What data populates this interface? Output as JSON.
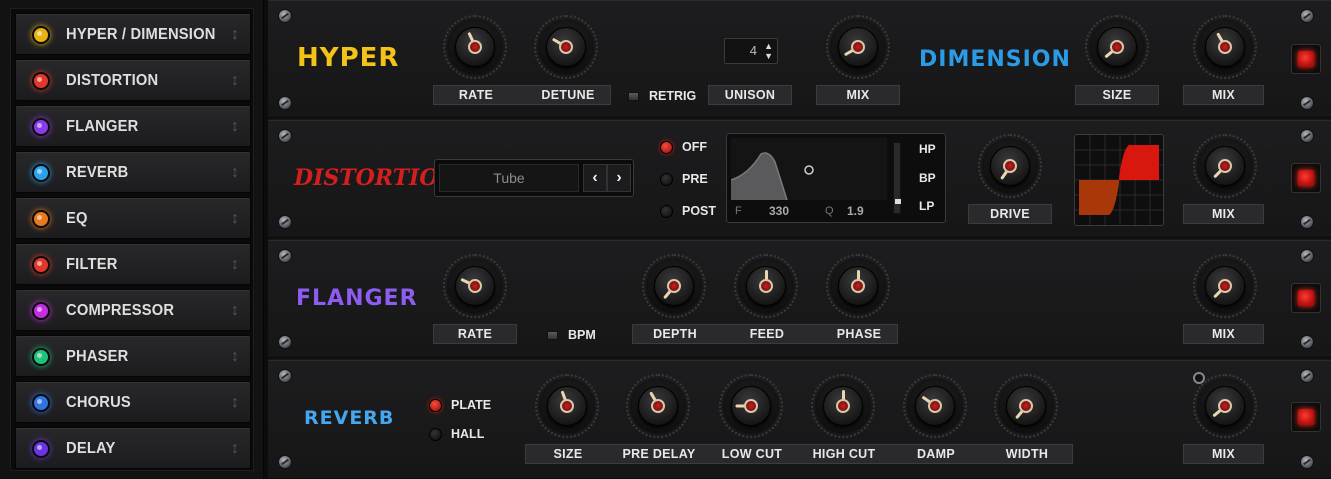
{
  "colors": {
    "hyper_title": "#f3c417",
    "dimension_title": "#2b9be6",
    "distortion_title": "#d51f1f",
    "flanger_title": "#8d5cf0",
    "reverb_title": "#45a7f0",
    "power_led": "#ff2a1a"
  },
  "sidebar": {
    "items": [
      {
        "label": "HYPER / DIMENSION",
        "led": "#e8b20f"
      },
      {
        "label": "DISTORTION",
        "led": "#e0392c"
      },
      {
        "label": "FLANGER",
        "led": "#8a3ae8"
      },
      {
        "label": "REVERB",
        "led": "#2aa3e8"
      },
      {
        "label": "EQ",
        "led": "#e8791c"
      },
      {
        "label": "FILTER",
        "led": "#e0392c"
      },
      {
        "label": "COMPRESSOR",
        "led": "#c22ee0"
      },
      {
        "label": "PHASER",
        "led": "#1fc27a"
      },
      {
        "label": "CHORUS",
        "led": "#2f74e0"
      },
      {
        "label": "DELAY",
        "led": "#6a34e0"
      }
    ]
  },
  "hyper": {
    "title": "HYPER",
    "rate_label": "RATE",
    "detune_label": "DETUNE",
    "retrig_label": "RETRIG",
    "unison_label": "UNISON",
    "unison_value": "4",
    "mix_label": "MIX",
    "dimension_title": "DIMENSION",
    "size_label": "SIZE",
    "dim_mix_label": "MIX"
  },
  "distortion": {
    "title": "DISTORTION",
    "type_value": "Tube",
    "off_label": "OFF",
    "pre_label": "PRE",
    "post_label": "POST",
    "filter_f_label": "F",
    "filter_f_value": "330",
    "filter_q_label": "Q",
    "filter_q_value": "1.9",
    "hp_label": "HP",
    "bp_label": "BP",
    "lp_label": "LP",
    "drive_label": "DRIVE",
    "mix_label": "MIX",
    "prev_icon": "‹",
    "next_icon": "›"
  },
  "flanger": {
    "title": "FLANGER",
    "rate_label": "RATE",
    "bpm_label": "BPM",
    "depth_label": "DEPTH",
    "feed_label": "FEED",
    "phase_label": "PHASE",
    "mix_label": "MIX"
  },
  "reverb": {
    "title": "REVERB",
    "plate_label": "PLATE",
    "hall_label": "HALL",
    "size_label": "SIZE",
    "predelay_label": "PRE DELAY",
    "lowcut_label": "LOW CUT",
    "highcut_label": "HIGH CUT",
    "damp_label": "DAMP",
    "width_label": "WIDTH",
    "mix_label": "MIX"
  }
}
